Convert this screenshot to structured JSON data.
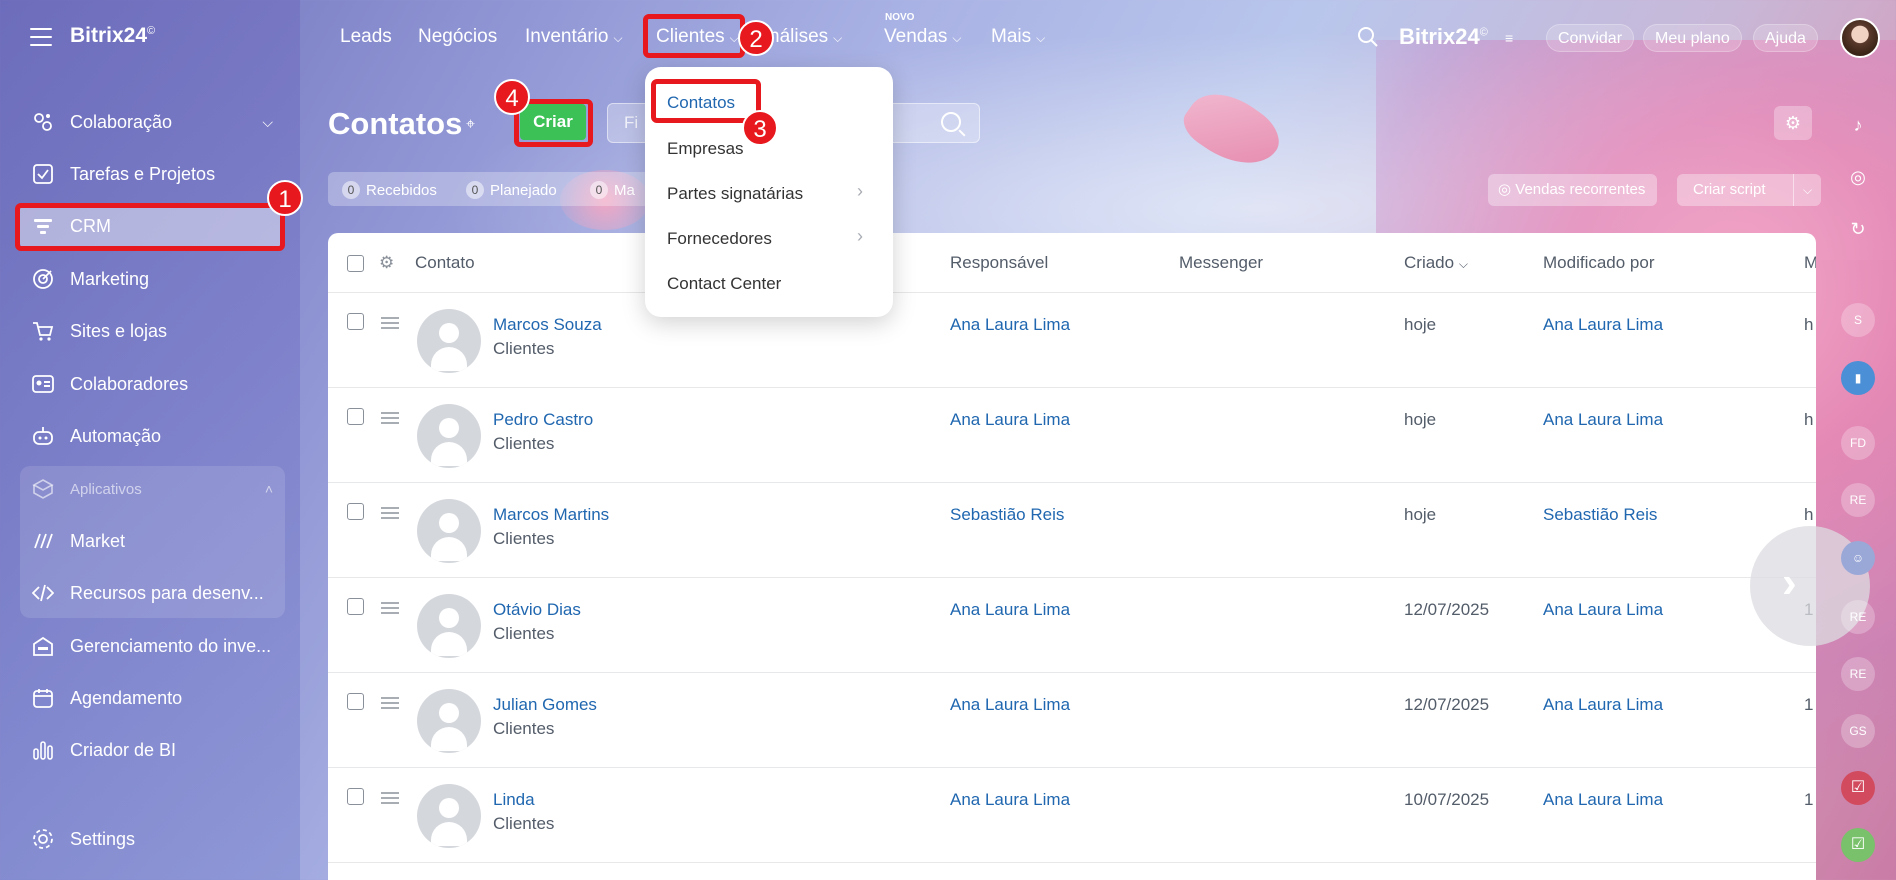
{
  "sidebar": {
    "logo": "Bitrix24",
    "logo_mark": "©",
    "items": [
      {
        "label": "Colaboração",
        "icon": "collaboration-icon"
      },
      {
        "label": "Tarefas e Projetos",
        "icon": "tasks-icon"
      },
      {
        "label": "CRM",
        "icon": "crm-funnel-icon"
      },
      {
        "label": "Marketing",
        "icon": "marketing-icon"
      },
      {
        "label": "Sites e lojas",
        "icon": "cart-icon"
      },
      {
        "label": "Colaboradores",
        "icon": "employees-icon"
      },
      {
        "label": "Automação",
        "icon": "robot-icon"
      },
      {
        "label": "Aplicativos",
        "icon": "apps-icon"
      },
      {
        "label": "Market",
        "icon": "market-icon"
      },
      {
        "label": "Recursos para desenv...",
        "icon": "code-icon"
      },
      {
        "label": "Gerenciamento do inve...",
        "icon": "inventory-icon"
      },
      {
        "label": "Agendamento",
        "icon": "calendar-icon"
      },
      {
        "label": "Criador de BI",
        "icon": "bi-chart-icon"
      },
      {
        "label": "Settings",
        "icon": "gear-icon"
      }
    ]
  },
  "topnav": {
    "items": [
      "Leads",
      "Negócios",
      "Inventário",
      "Clientes",
      "Análises",
      "Vendas",
      "Mais"
    ],
    "analises_visible": "nálises",
    "novo_badge": "NOVO",
    "brand": "Bitrix24",
    "invite": "Convidar",
    "plan": "Meu plano",
    "help": "Ajuda"
  },
  "page": {
    "title": "Contatos",
    "create_button": "Criar",
    "search_placeholder": "Fi",
    "counters": [
      {
        "n": "0",
        "label": "Recebidos"
      },
      {
        "n": "0",
        "label": "Planejado"
      },
      {
        "n": "0",
        "label": "Ma"
      }
    ],
    "recurring_sales": "Vendas recorrentes",
    "create_script": "Criar script"
  },
  "dropdown": {
    "items": [
      "Contatos",
      "Empresas",
      "Partes signatárias",
      "Fornecedores",
      "Contact Center"
    ]
  },
  "table": {
    "columns": [
      "Contato",
      "Responsável",
      "Messenger",
      "Criado",
      "Modificado por",
      "M"
    ],
    "rows": [
      {
        "name": "Marcos Souza",
        "type": "Clientes",
        "owner": "Ana Laura Lima",
        "created": "hoje",
        "modified_by": "Ana Laura Lima",
        "cut": "h"
      },
      {
        "name": "Pedro Castro",
        "type": "Clientes",
        "owner": "Ana Laura Lima",
        "created": "hoje",
        "modified_by": "Ana Laura Lima",
        "cut": "h"
      },
      {
        "name": "Marcos Martins",
        "type": "Clientes",
        "owner": "Sebastião Reis",
        "created": "hoje",
        "modified_by": "Sebastião Reis",
        "cut": "h"
      },
      {
        "name": "Otávio Dias",
        "type": "Clientes",
        "owner": "Ana Laura Lima",
        "created": "12/07/2025",
        "modified_by": "Ana Laura Lima",
        "cut": "1"
      },
      {
        "name": "Julian Gomes",
        "type": "Clientes",
        "owner": "Ana Laura Lima",
        "created": "12/07/2025",
        "modified_by": "Ana Laura Lima",
        "cut": "1"
      },
      {
        "name": "Linda",
        "type": "Clientes",
        "owner": "Ana Laura Lima",
        "created": "10/07/2025",
        "modified_by": "Ana Laura Lima",
        "cut": "1"
      }
    ]
  },
  "rail": [
    "S",
    "FD",
    "RE",
    "RE",
    "RE",
    "GS"
  ],
  "annotations": [
    "1",
    "2",
    "3",
    "4"
  ],
  "colors": {
    "accent_green": "#3bc155",
    "link_blue": "#2067b0",
    "annotation_red": "#e8191e"
  }
}
